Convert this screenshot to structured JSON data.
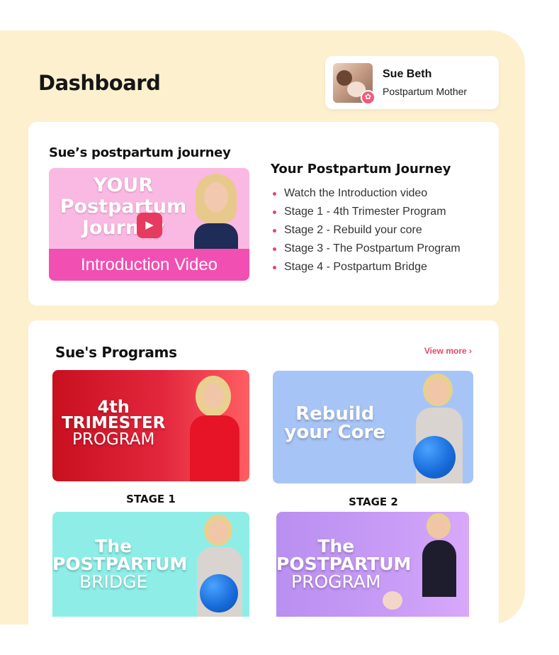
{
  "dashboard": {
    "title": "Dashboard"
  },
  "profile": {
    "name": "Sue Beth",
    "role": "Postpartum Mother",
    "avatar_icon": "mother-with-baby-avatar",
    "badge_icon": "baby-stroller-icon",
    "badge_color": "#f05a79"
  },
  "journey": {
    "card_title": "Sue’s postpartum journey",
    "video": {
      "title_lines": [
        "YOUR",
        "Postpartum",
        "Journey"
      ],
      "subtitle": "Introduction Video",
      "play_icon": "play-icon"
    },
    "steps_title": "Your Postpartum Journey",
    "steps": [
      "Watch the Introduction video",
      "Stage 1 - 4th Trimester Program",
      "Stage 2 - Rebuild your core",
      "Stage 3 - The Postpartum Program",
      "Stage 4 - Postpartum Bridge"
    ]
  },
  "programs": {
    "title": "Sue's Programs",
    "view_more": "View more ›",
    "items": [
      {
        "lines": [
          "4th",
          "TRIMESTER",
          "PROGRAM"
        ],
        "stage": "STAGE 1",
        "color": "#e2263c"
      },
      {
        "lines": [
          "Rebuild",
          "your Core"
        ],
        "stage": "STAGE 2",
        "color": "#a7c4f6"
      },
      {
        "lines": [
          "The",
          "POSTPARTUM",
          "BRIDGE"
        ],
        "stage": "",
        "color": "#8eeee7"
      },
      {
        "lines": [
          "The",
          "POSTPARTUM",
          "PROGRAM"
        ],
        "stage": "",
        "color": "#b98ff0"
      }
    ]
  },
  "theme": {
    "accent": "#e8456a",
    "backdrop": "#fdf0cf"
  }
}
